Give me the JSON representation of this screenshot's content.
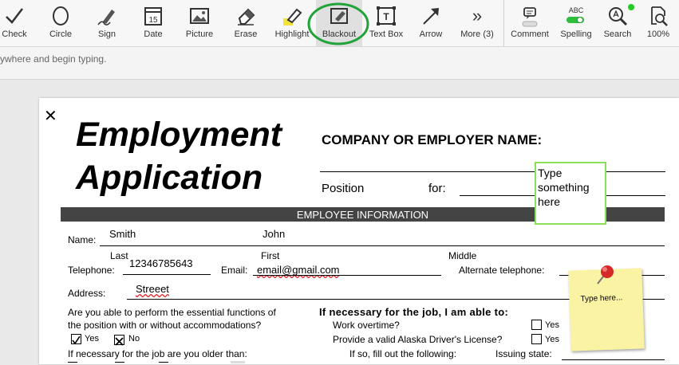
{
  "toolbar": {
    "tools": [
      {
        "id": "check",
        "label": "Check"
      },
      {
        "id": "circle",
        "label": "Circle"
      },
      {
        "id": "sign",
        "label": "Sign"
      },
      {
        "id": "date",
        "label": "Date",
        "icon_text": "15"
      },
      {
        "id": "picture",
        "label": "Picture"
      },
      {
        "id": "erase",
        "label": "Erase"
      },
      {
        "id": "highlight",
        "label": "Highlight"
      },
      {
        "id": "blackout",
        "label": "Blackout"
      },
      {
        "id": "textbox",
        "label": "Text Box",
        "icon_text": "T"
      },
      {
        "id": "arrow",
        "label": "Arrow"
      },
      {
        "id": "more",
        "label": "More (3)",
        "icon_text": "»"
      },
      {
        "id": "comment",
        "label": "Comment"
      },
      {
        "id": "spelling",
        "label": "Spelling",
        "icon_text": "ABC"
      },
      {
        "id": "search",
        "label": "Search"
      },
      {
        "id": "zoom",
        "label": "100%"
      }
    ],
    "highlight_circle_color": "#22a33a",
    "status_dot_color": "#22cc22"
  },
  "hint_text": "ywhere and begin typing.",
  "doc": {
    "close_glyph": "✕",
    "title_line1": "Employment",
    "title_line2": "Application",
    "company_label": "COMPANY OR EMPLOYER NAME:",
    "position_label": "Position",
    "for_label": "for:",
    "textbox_text": "Type something here",
    "section_header": "EMPLOYEE INFORMATION",
    "name_label": "Name:",
    "name_first_value": "Smith",
    "name_second_value": "John",
    "last_label": "Last",
    "first_label": "First",
    "middle_label": "Middle",
    "telephone_label": "Telephone:",
    "telephone_value": "12346785643",
    "email_label": "Email:",
    "email_value": "email@gmail.com",
    "alt_phone_label": "Alternate telephone:",
    "address_label": "Address:",
    "address_value": "Streeet",
    "q_essential_line1": "Are you able to perform the essential functions of",
    "q_essential_line2": "the position with or without accommodations?",
    "yes_label": "Yes",
    "no_label": "No",
    "q_older": "If necessary for the job are you older than:",
    "if_necessary_heading": "If necessary for the job, I am able to:",
    "work_overtime": "Work overtime?",
    "alaska_license": "Provide a valid Alaska Driver's License?",
    "fill_following": "If so, fill out the following:",
    "issuing_state": "Issuing state:",
    "sticky_note_text": "Type here..."
  }
}
